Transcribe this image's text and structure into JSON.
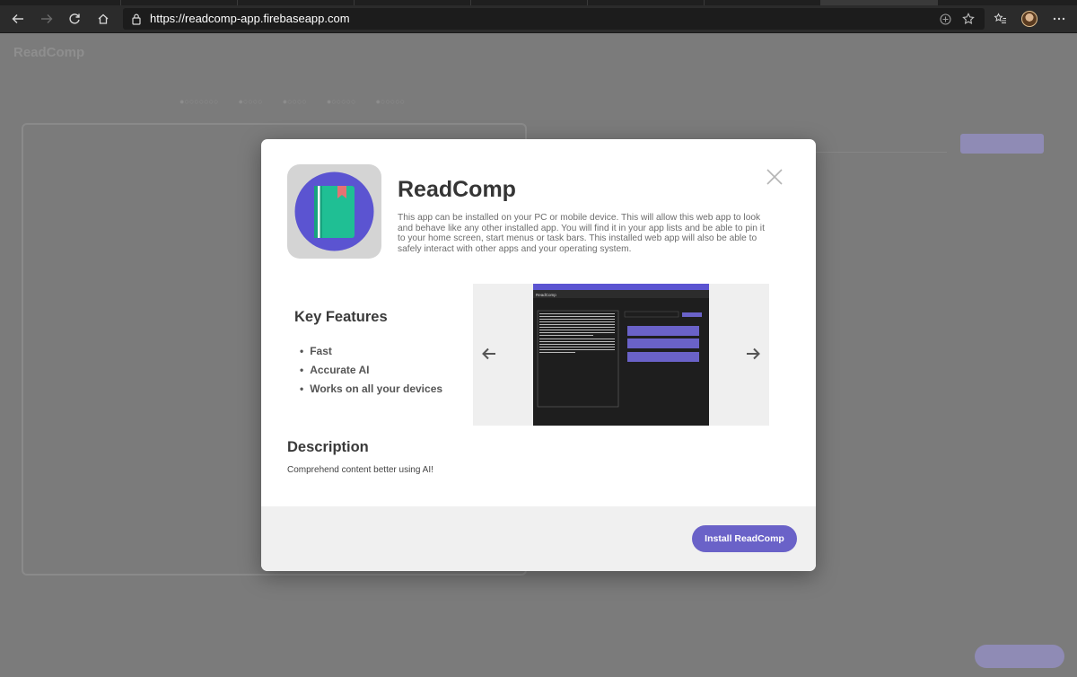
{
  "browser": {
    "url": "https://readcomp-app.firebaseapp.com"
  },
  "page": {
    "app_title": "ReadComp"
  },
  "modal": {
    "app_name": "ReadComp",
    "install_description": "This app can be installed on your PC or mobile device. This will allow this web app to look and behave like any other installed app. You will find it in your app lists and be able to pin it to your home screen, start menus or task bars. This installed web app will also be able to safely interact with other apps and your operating system.",
    "key_features_title": "Key Features",
    "features": [
      "Fast",
      "Accurate AI",
      "Works on all your devices"
    ],
    "description_title": "Description",
    "description_text": "Comprehend content better using AI!",
    "install_button": "Install ReadComp",
    "icon": "book-with-bookmark-icon",
    "screenshot_app_name": "ReadComp"
  },
  "colors": {
    "accent": "#6a62c8",
    "icon_circle": "#5b54d1",
    "book": "#1fbf94",
    "bookmark": "#e57373"
  }
}
